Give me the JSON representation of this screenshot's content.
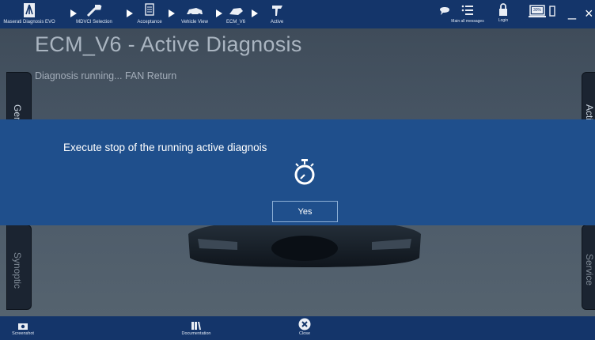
{
  "topbar": {
    "breadcrumbs": [
      {
        "label": "Maserati Diagnosis EVO",
        "icon": "maserati-logo-icon"
      },
      {
        "label": "MDVCI Selection",
        "icon": "mdvci-device-icon"
      },
      {
        "label": "Acceptance",
        "icon": "document-icon"
      },
      {
        "label": "Vehicle View",
        "icon": "car-icon"
      },
      {
        "label": "ECM_V6",
        "icon": "ecm-module-icon"
      },
      {
        "label": "Active",
        "icon": "active-diagnosis-icon"
      }
    ],
    "messages_label": "Main all messages",
    "login_label": "Login",
    "battery_text": "30%",
    "minimize_glyph": "_",
    "close_glyph": "×"
  },
  "main": {
    "title": "ECM_V6 - Active Diagnosis",
    "status": "Diagnosis running... FAN Return"
  },
  "left_tabs": [
    {
      "label": "General"
    },
    {
      "label": "Synoptic"
    }
  ],
  "right_tabs": [
    {
      "label": "Activities"
    },
    {
      "label": "Service"
    }
  ],
  "dialog": {
    "message": "Execute stop of the running active diagnois",
    "icon": "stopwatch-icon",
    "yes_label": "Yes"
  },
  "bottombar": {
    "screenshot_label": "Screenshot",
    "documentation_label": "Documentation",
    "close_label": "Close"
  },
  "colors": {
    "topbar": "#14356a",
    "dialog": "#1f4f8c",
    "background": "#4b5866"
  }
}
